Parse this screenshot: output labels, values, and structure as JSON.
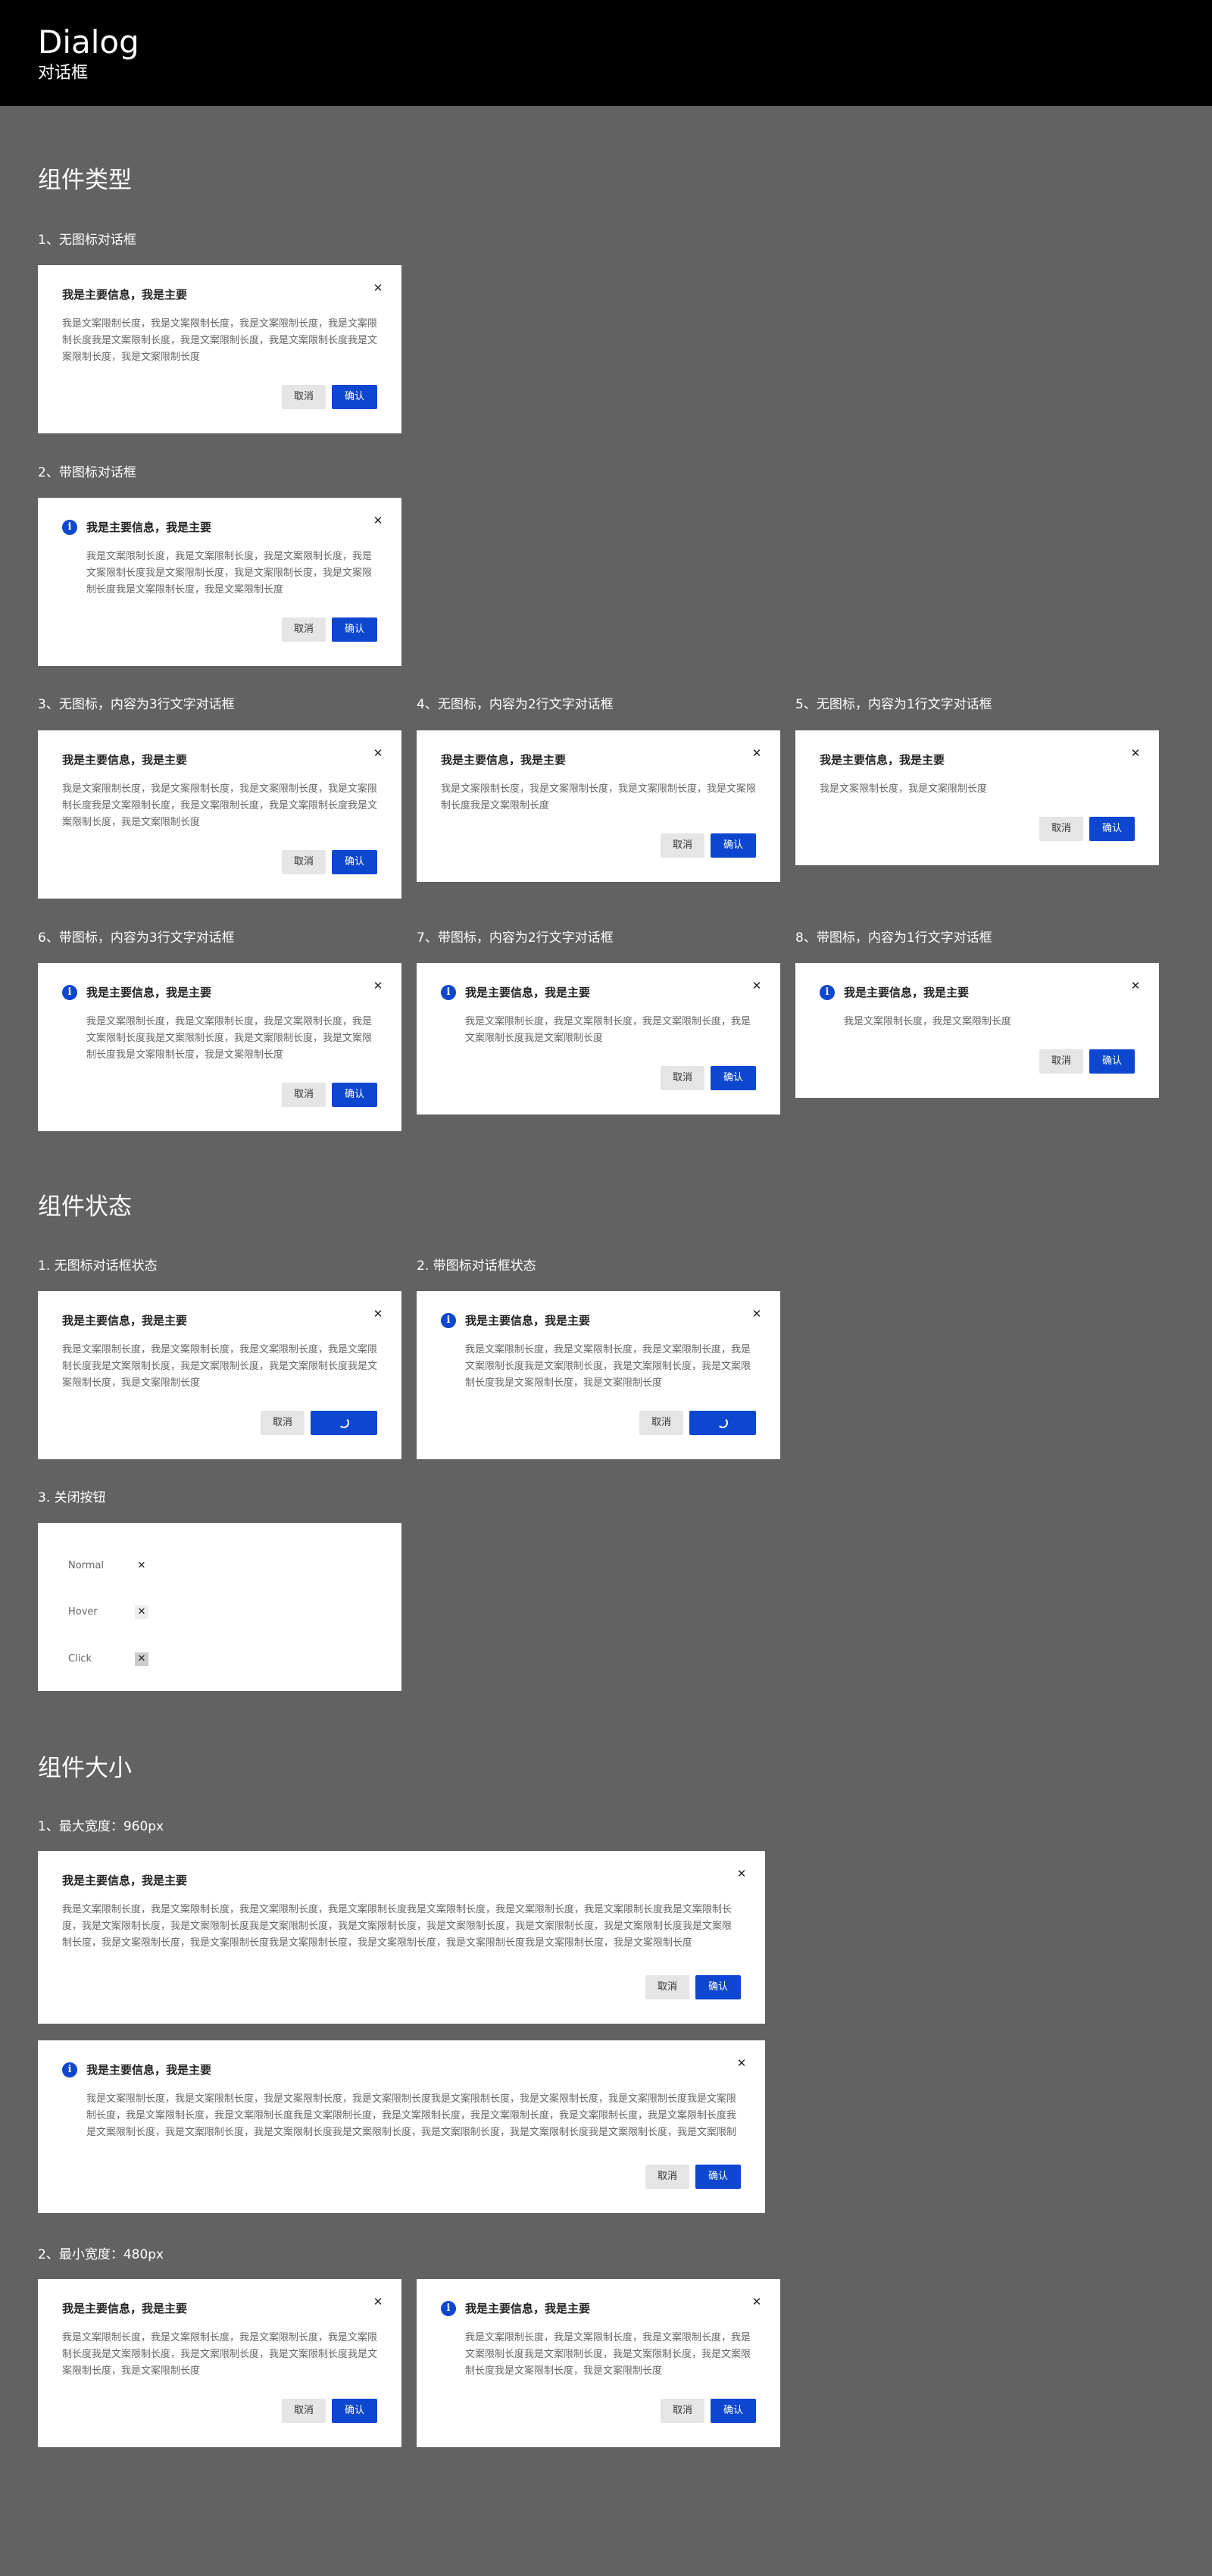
{
  "header": {
    "title": "Dialog",
    "subtitle": "对话框"
  },
  "colors": {
    "primary": "#0d47cf",
    "cancel_bg": "#e5e5e5",
    "page_bg": "#626262"
  },
  "dialog": {
    "title": "我是主要信息，我是主要",
    "body_long": "我是文案限制长度，我是文案限制长度，我是文案限制长度，我是文案限制长度我是文案限制长度，我是文案限制长度，我是文案限制长度我是文案限制长度，我是文案限制长度",
    "body_2line": "我是文案限制长度，我是文案限制长度，我是文案限制长度，我是文案限制长度我是文案限制长度",
    "body_1line": "我是文案限制长度，我是文案限制长度",
    "body_wide": "我是文案限制长度，我是文案限制长度，我是文案限制长度，我是文案限制长度我是文案限制长度，我是文案限制长度，我是文案限制长度我是文案限制长度，我是文案限制长度，我是文案限制长度我是文案限制长度，我是文案限制长度，我是文案限制长度，我是文案限制长度，我是文案限制长度我是文案限制长度，我是文案限制长度，我是文案限制长度我是文案限制长度，我是文案限制长度，我是文案限制长度我是文案限制长度，我是文案限制长度",
    "cancel": "取消",
    "confirm": "确认",
    "close_icon": "close-icon",
    "info_icon": "info-icon"
  },
  "sections": {
    "types": {
      "title": "组件类型",
      "items": [
        "1、无图标对话框",
        "2、带图标对话框",
        "3、无图标，内容为3行文字对话框",
        "4、无图标，内容为2行文字对话框",
        "5、无图标，内容为1行文字对话框",
        "6、带图标，内容为3行文字对话框",
        "7、带图标，内容为2行文字对话框",
        "8、带图标，内容为1行文字对话框"
      ]
    },
    "states": {
      "title": "组件状态",
      "items": [
        "1. 无图标对话框状态",
        "2. 带图标对话框状态",
        "3. 关闭按钮"
      ],
      "close_states": [
        "Normal",
        "Hover",
        "Click"
      ]
    },
    "sizes": {
      "title": "组件大小",
      "items": [
        "1、最大宽度：960px",
        "2、最小宽度：480px"
      ]
    }
  }
}
